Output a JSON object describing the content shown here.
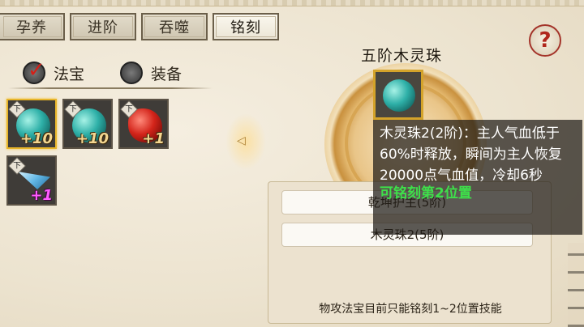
{
  "tabs": [
    "孕养",
    "进阶",
    "吞噬",
    "铭刻"
  ],
  "active_tab": "铭刻",
  "help_icon": "question-mark-icon",
  "filters": {
    "fabao_label": "法宝",
    "equip_label": "装备"
  },
  "items": [
    {
      "grade": "下",
      "gem": "teal",
      "plus": "+10"
    },
    {
      "grade": "下",
      "gem": "teal",
      "plus": "+10"
    },
    {
      "grade": "下",
      "gem": "red",
      "plus": "+1"
    },
    {
      "grade": "下",
      "gem": "blue",
      "plus": "+1"
    }
  ],
  "selected_item": {
    "name": "五阶木灵珠"
  },
  "engrave_slots": [
    {
      "label": "乾坤护主(5阶)"
    },
    {
      "label": "木灵珠2(5阶)"
    }
  ],
  "panel_note": "物攻法宝目前只能铭刻1~2位置技能",
  "tooltip": {
    "description": "木灵珠2(2阶)：主人气血低于60%时释放，瞬间为主人恢复20000点气血值，冷却6秒",
    "hint": "可铭刻第2位置"
  },
  "colors": {
    "tooltip_hint": "#3ee04a",
    "selected_border": "#e8b52a",
    "help_accent": "#b0261c"
  }
}
